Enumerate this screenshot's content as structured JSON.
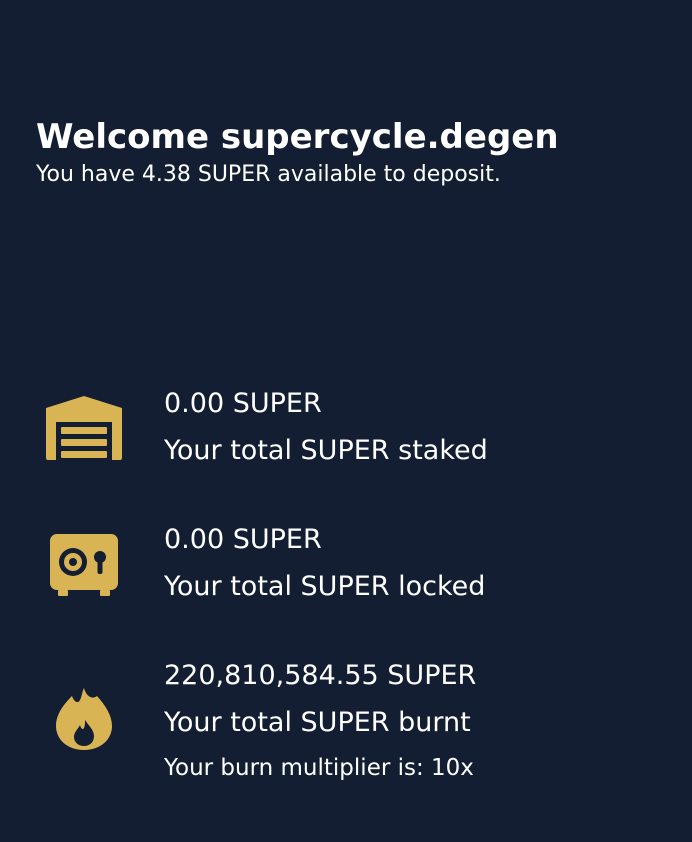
{
  "colors": {
    "background": "#141e33",
    "text": "#ffffff",
    "icon_accent": "#d9b455"
  },
  "welcome": {
    "title": "Welcome supercycle.degen",
    "subtitle": "You have 4.38 SUPER available to deposit."
  },
  "stats": {
    "staked": {
      "icon": "warehouse-icon",
      "value": "0.00 SUPER",
      "label": "Your total SUPER staked"
    },
    "locked": {
      "icon": "vault-icon",
      "value": "0.00 SUPER",
      "label": "Your total SUPER locked"
    },
    "burnt": {
      "icon": "fire-icon",
      "value": "220,810,584.55 SUPER",
      "label": "Your total SUPER burnt",
      "multiplier": "Your burn multiplier is: 10x"
    }
  }
}
